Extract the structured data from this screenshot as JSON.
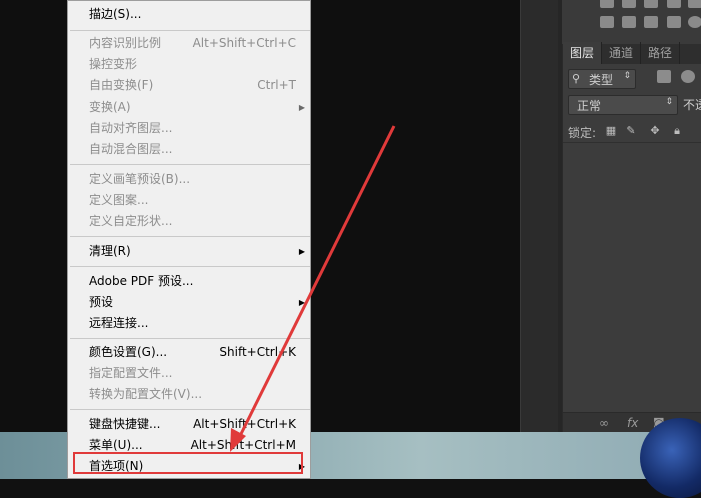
{
  "layers_panel": {
    "tabs": [
      "图层",
      "通道",
      "路径"
    ],
    "filter_label": "类型",
    "blend_mode": "正常",
    "opacity_label": "不透",
    "lock_label": "锁定:"
  },
  "menu": {
    "items": [
      {
        "label": "描边(S)...",
        "shortcut": "",
        "enabled": true
      },
      {
        "label": "内容识别比例",
        "shortcut": "Alt+Shift+Ctrl+C",
        "enabled": false
      },
      {
        "label": "操控变形",
        "shortcut": "",
        "enabled": false
      },
      {
        "label": "自由变换(F)",
        "shortcut": "Ctrl+T",
        "enabled": false
      },
      {
        "label": "变换(A)",
        "shortcut": "",
        "enabled": false
      },
      {
        "label": "自动对齐图层...",
        "shortcut": "",
        "enabled": false
      },
      {
        "label": "自动混合图层...",
        "shortcut": "",
        "enabled": false
      },
      {
        "label": "定义画笔预设(B)...",
        "shortcut": "",
        "enabled": false
      },
      {
        "label": "定义图案...",
        "shortcut": "",
        "enabled": false
      },
      {
        "label": "定义自定形状...",
        "shortcut": "",
        "enabled": false
      },
      {
        "label": "清理(R)",
        "shortcut": "",
        "enabled": true
      },
      {
        "label": "Adobe PDF 预设...",
        "shortcut": "",
        "enabled": true
      },
      {
        "label": "预设",
        "shortcut": "",
        "enabled": true
      },
      {
        "label": "远程连接...",
        "shortcut": "",
        "enabled": true
      },
      {
        "label": "颜色设置(G)...",
        "shortcut": "Shift+Ctrl+K",
        "enabled": true
      },
      {
        "label": "指定配置文件...",
        "shortcut": "",
        "enabled": false
      },
      {
        "label": "转换为配置文件(V)...",
        "shortcut": "",
        "enabled": false
      },
      {
        "label": "键盘快捷键...",
        "shortcut": "Alt+Shift+Ctrl+K",
        "enabled": true
      },
      {
        "label": "菜单(U)...",
        "shortcut": "Alt+Shift+Ctrl+M",
        "enabled": true
      },
      {
        "label": "首选项(N)",
        "shortcut": "",
        "enabled": true
      }
    ]
  },
  "icons": [
    "search-icon",
    "image-filter-icon",
    "adjustment-filter-icon",
    "lock-transparent-icon",
    "lock-brush-icon",
    "lock-move-icon",
    "lock-all-icon",
    "link-icon",
    "fx-icon",
    "mask-icon",
    "new-adjustment-icon"
  ],
  "colors": {
    "highlight_box": "#e03a3a",
    "annotation_arrow": "#e03a3a"
  }
}
